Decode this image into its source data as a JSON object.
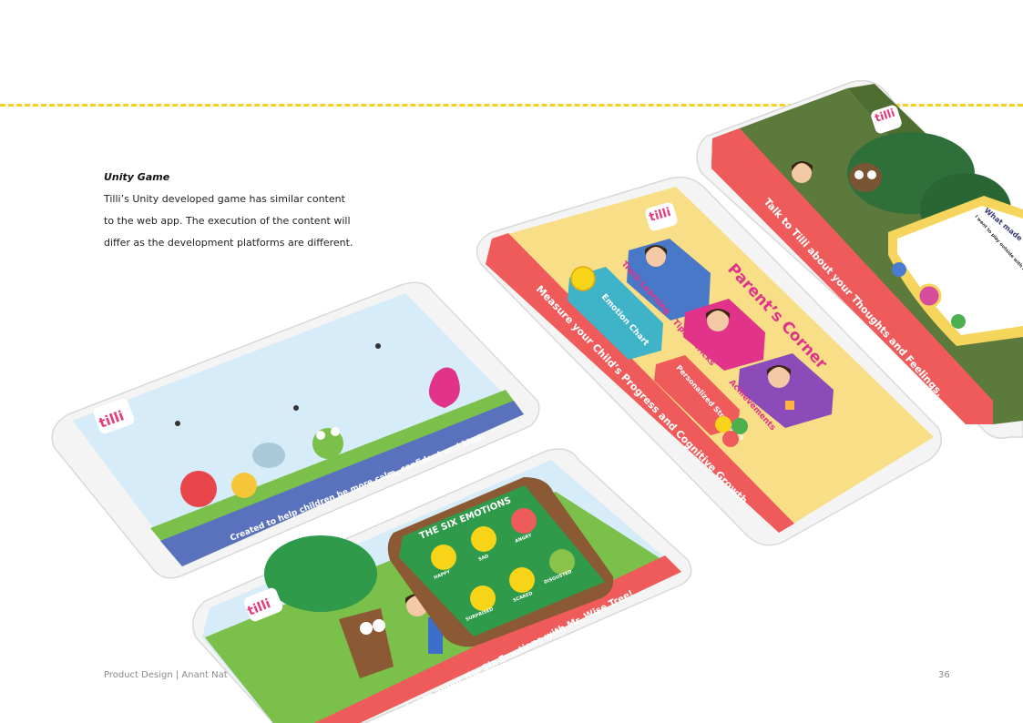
{
  "section": {
    "title": "Unity Game",
    "body_lines": [
      "Tilli’s Unity developed game has similar content",
      "to the web app. The execution of the content will",
      "differ as the development platforms are different."
    ]
  },
  "footer": {
    "left": "Product Design | Anant Nat",
    "page_number": "36"
  },
  "logo_text": "tilli",
  "phone1": {
    "banner": "Created to help children be more calm, confident and kind!"
  },
  "phone2": {
    "banner": "Learn about the Six Emotions with Mr. Wise Tree!",
    "card_title": "THE SIX EMOTIONS",
    "emotions": [
      "HAPPY",
      "SAD",
      "ANGRY",
      "SURPRISED",
      "SCARED",
      "DISGUSTED"
    ]
  },
  "phone3": {
    "banner": "Measure your Child’s Progress and Cognitive Growth",
    "heading": "Parent’s Corner",
    "tiles": [
      "Track Learning",
      "Emotion Chart",
      "Tips & Tricks",
      "Personalized Strategies",
      "Achievements"
    ]
  },
  "phone4": {
    "banner": "Talk to Tilli about your Thoughts and Feelings.",
    "dialog_title": "What made",
    "dialog_text": "I went to play outside with my"
  },
  "colors": {
    "dash": "#f7cf1e",
    "banner_blue": "#5a72be",
    "banner_red": "#ef5b5b",
    "parent_bg": "#f8df87",
    "grass": "#7ac04b",
    "card_green": "#2e9a4a"
  }
}
